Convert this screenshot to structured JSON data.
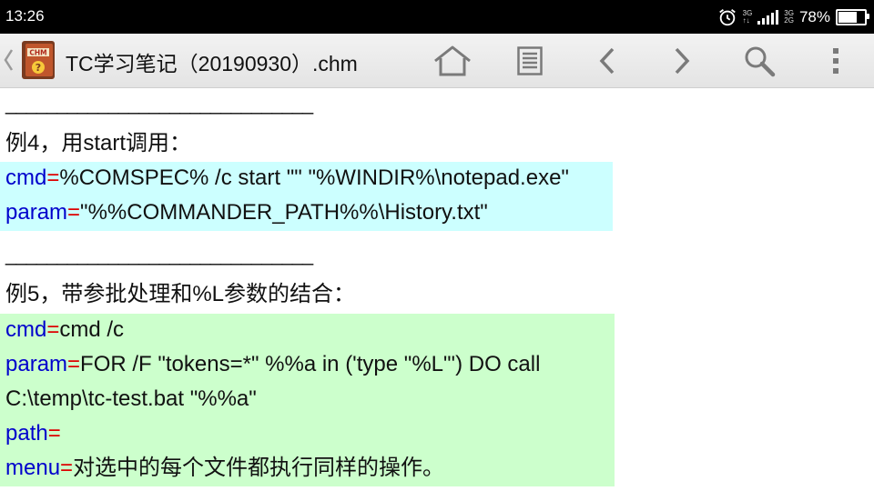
{
  "status_bar": {
    "time": "13:26",
    "net_top_left": "3G",
    "net_bottom_left": "↑↓",
    "net_top_right": "3G",
    "net_bottom_right": "2G",
    "battery_percent": "78%",
    "battery_level": 0.78,
    "icons": [
      "alarm-icon",
      "signal-icon",
      "battery-icon"
    ]
  },
  "app_bar": {
    "icon_label": "CHM",
    "icon_mark": "?",
    "title": "TC学习笔记（20190930）.chm",
    "toolbar": [
      "home-icon",
      "toc-list-icon",
      "chevron-left-icon",
      "chevron-right-icon",
      "search-icon",
      "more-vert-icon"
    ]
  },
  "content": {
    "separator": "______________________________",
    "example4": {
      "heading": "例4，用start调用：",
      "lines": [
        {
          "key": "cmd",
          "eq": "=",
          "value": "%COMSPEC% /c start \"\" \"%WINDIR%\\notepad.exe\""
        },
        {
          "key": "param",
          "eq": "=",
          "value": "\"%%COMMANDER_PATH%%\\History.txt\""
        }
      ]
    },
    "example5": {
      "heading": "例5，带参批处理和%L参数的结合：",
      "lines": [
        {
          "key": "cmd",
          "eq": "=",
          "value": "cmd /c"
        },
        {
          "key": "param",
          "eq": "=",
          "value": "FOR /F \"tokens=*\" %%a in ('type \"%L\"') DO call"
        },
        {
          "key": "",
          "eq": "",
          "value": "C:\\temp\\tc-test.bat \"%%a\""
        },
        {
          "key": "path",
          "eq": "=",
          "value": ""
        },
        {
          "key": "menu",
          "eq": "=",
          "value": "对选中的每个文件都执行同样的操作。"
        }
      ]
    }
  },
  "colors": {
    "block1_bg": "#ccffff",
    "block2_bg": "#ccffcc",
    "key": "#0000cc",
    "equals": "#dd0000"
  }
}
